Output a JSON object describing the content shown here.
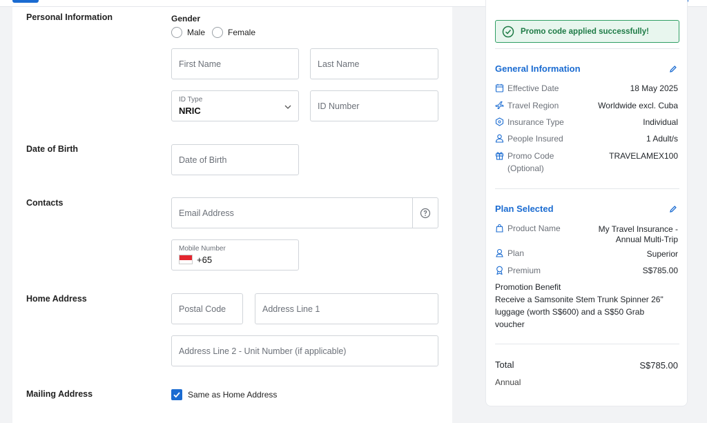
{
  "sections": {
    "personal": "Personal Information",
    "dob": "Date of Birth",
    "contacts": "Contacts",
    "home": "Home Address",
    "mailing": "Mailing Address"
  },
  "gender": {
    "label": "Gender",
    "options": [
      "Male",
      "Female"
    ]
  },
  "fields": {
    "first_name": "First Name",
    "last_name": "Last Name",
    "id_type_label": "ID Type",
    "id_type_value": "NRIC",
    "id_number": "ID Number",
    "dob": "Date of Birth",
    "email": "Email Address",
    "mobile_label": "Mobile Number",
    "mobile_code": "+65",
    "postal_code": "Postal Code",
    "address_line1": "Address Line 1",
    "address_line2": "Address Line 2 - Unit Number (if applicable)"
  },
  "mailing": {
    "same_as_home_label": "Same as Home Address",
    "checked": true
  },
  "summary": {
    "promo_message": "Promo code applied successfully!",
    "general": {
      "title": "General Information",
      "rows": [
        {
          "label": "Effective Date",
          "value": "18 May 2025",
          "icon": "calendar-icon"
        },
        {
          "label": "Travel Region",
          "value": "Worldwide excl. Cuba",
          "icon": "airplane-icon"
        },
        {
          "label": "Insurance Type",
          "value": "Individual",
          "icon": "shield-icon"
        },
        {
          "label": "People Insured",
          "value": "1 Adult/s",
          "icon": "person-icon"
        },
        {
          "label": "Promo Code",
          "label2": "(Optional)",
          "value": "TRAVELAMEX100",
          "icon": "gift-icon"
        }
      ]
    },
    "plan": {
      "title": "Plan Selected",
      "rows": [
        {
          "label": "Product Name",
          "value": "My Travel Insurance -",
          "value2": "Annual Multi-Trip",
          "icon": "bag-icon"
        },
        {
          "label": "Plan",
          "value": "Superior",
          "icon": "plan-icon"
        },
        {
          "label": "Premium",
          "value": "S$785.00",
          "icon": "badge-icon"
        }
      ],
      "promotion_title": "Promotion Benefit",
      "promotion_text": "Receive a Samsonite Stem Trunk Spinner 26\" luggage (worth S$600) and a S$50 Grab voucher"
    },
    "total": {
      "label": "Total",
      "value": "S$785.00",
      "period": "Annual"
    }
  },
  "colors": {
    "accent": "#1a6bd1",
    "success": "#1d7a45",
    "success_bg": "#e8f6ee"
  }
}
